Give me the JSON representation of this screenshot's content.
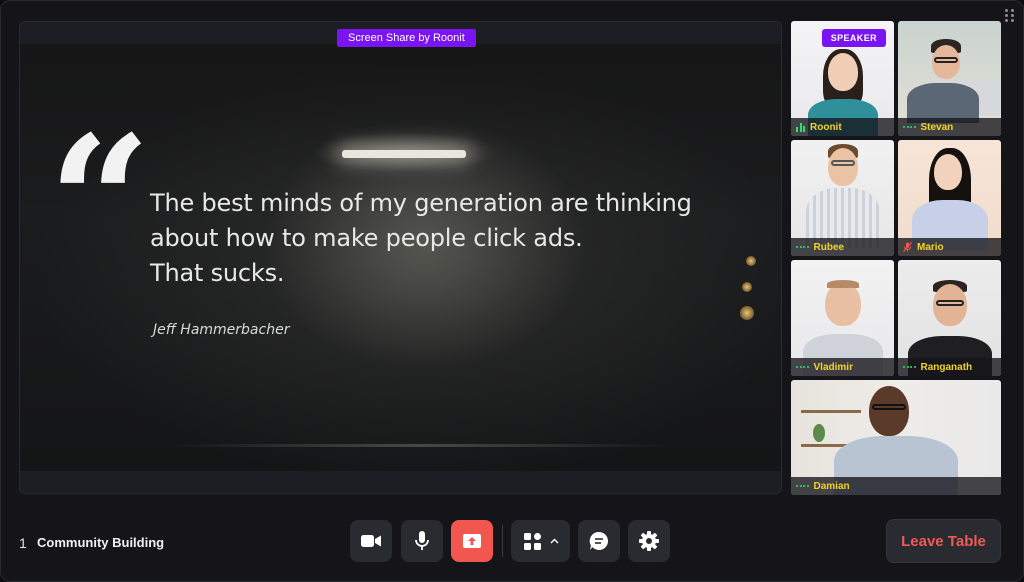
{
  "share": {
    "badge": "Screen Share by Roonit",
    "quote_mark": "“",
    "quote_text": "The best minds of my generation are thinking\nabout how to make people click ads.\nThat sucks.",
    "quote_author": "Jeff Hammerbacher"
  },
  "participants": [
    {
      "name": "Roonit",
      "status": "speaking",
      "badge": "SPEAKER"
    },
    {
      "name": "Stevan",
      "status": "audio-on"
    },
    {
      "name": "Rubee",
      "status": "audio-on"
    },
    {
      "name": "Mario",
      "status": "muted"
    },
    {
      "name": "Vladimir",
      "status": "audio-on"
    },
    {
      "name": "Ranganath",
      "status": "audio-on"
    },
    {
      "name": "Damian",
      "status": "audio-on"
    }
  ],
  "footer": {
    "table_number": "1",
    "table_name": "Community Building",
    "controls": [
      "camera-icon",
      "microphone-icon",
      "screen-share-icon",
      "layout-grid-icon",
      "chat-icon",
      "settings-icon"
    ],
    "leave_label": "Leave Table"
  },
  "colors": {
    "accent": "#7a14f2",
    "danger": "#f1574f",
    "name": "#f3d428",
    "audio": "#2ee06b"
  }
}
